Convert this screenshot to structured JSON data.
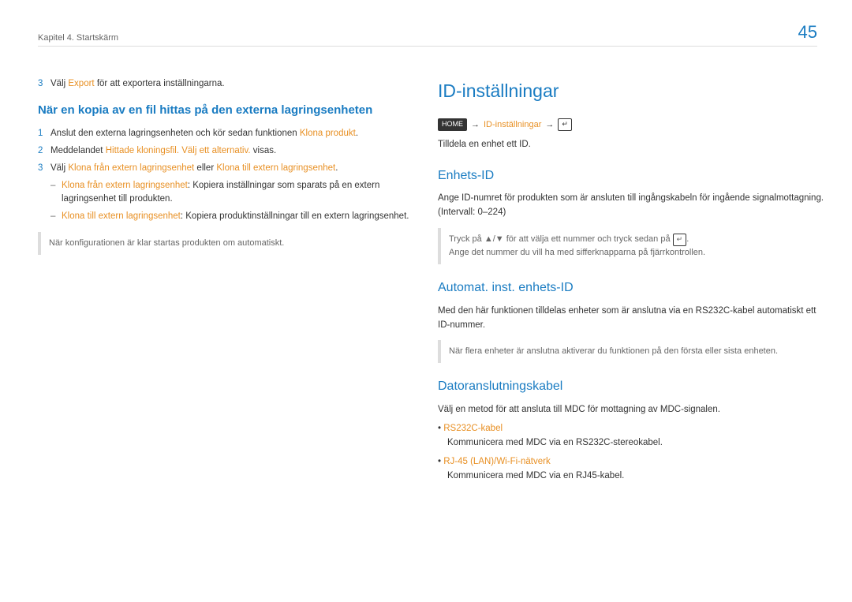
{
  "page_number": "45",
  "chapter": "Kapitel 4. Startskärm",
  "left_col": {
    "step3_pre": "Välj",
    "step3_accent": "Export",
    "step3_post": "för att exportera inställningarna.",
    "heading": "När en kopia av en fil hittas på den externa lagringsenheten",
    "s1_pre": "Anslut den externa lagringsenheten och kör sedan funktionen",
    "s1_accent": "Klona produkt",
    "s1_post": ".",
    "s2_pre": "Meddelandet",
    "s2_accent": "Hittade kloningsfil. Välj ett alternativ.",
    "s2_post": "visas.",
    "s3_pre": "Välj",
    "s3_accent1": "Klona från extern lagringsenhet",
    "s3_mid": "eller",
    "s3_accent2": "Klona till extern lagringsenhet",
    "s3_post": ".",
    "b1_accent": "Klona från extern lagringsenhet",
    "b1_text": ": Kopiera inställningar som sparats på en extern lagringsenhet till produkten.",
    "b2_accent": "Klona till extern lagringsenhet",
    "b2_text": ": Kopiera produktinställningar till en extern lagringsenhet.",
    "note": "När konfigurationen är klar startas produkten om automatiskt."
  },
  "right_col": {
    "main_heading": "ID-inställningar",
    "crumb_home": "HOME",
    "crumb_arrow": "→",
    "crumb_item": "ID-inställningar",
    "assign_text": "Tilldela en enhet ett ID.",
    "sec1_h": "Enhets-ID",
    "sec1_p": "Ange ID-numret för produkten som är ansluten till ingångskabeln för ingående signalmottagning. (Intervall: 0–224)",
    "sec1_note1_pre": "Tryck på ▲/▼ för att välja ett nummer och tryck sedan på",
    "sec1_note1_post": ".",
    "sec1_note2": "Ange det nummer du vill ha med sifferknapparna på fjärrkontrollen.",
    "sec2_h": "Automat. inst. enhets-ID",
    "sec2_p": "Med den här funktionen tilldelas enheter som är anslutna via en RS232C-kabel automatiskt ett ID-nummer.",
    "sec2_note": "När flera enheter är anslutna aktiverar du funktionen på den första eller sista enheten.",
    "sec3_h": "Datoranslutningskabel",
    "sec3_p": "Välj en metod för att ansluta till MDC för mottagning av MDC-signalen.",
    "sec3_opt1_label": "RS232C-kabel",
    "sec3_opt1_text": "Kommunicera med MDC via en RS232C-stereokabel.",
    "sec3_opt2_label": "RJ-45 (LAN)/Wi-Fi-nätverk",
    "sec3_opt2_text": "Kommunicera med MDC via en RJ45-kabel."
  }
}
